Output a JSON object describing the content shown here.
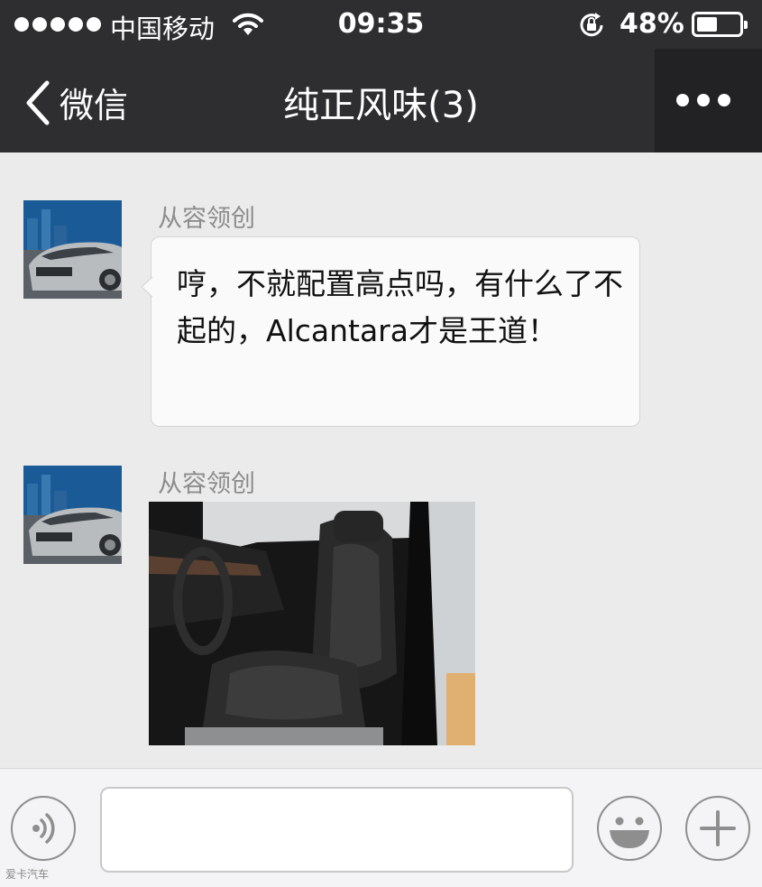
{
  "status_bar": {
    "carrier": "中国移动",
    "time": "09:35",
    "battery": "48%",
    "battery_level": 0.48,
    "signal_icon": "signal-dots-icon",
    "wifi_icon": "wifi-icon",
    "rotation_lock_icon": "rotation-lock-icon"
  },
  "nav": {
    "back_label": "微信",
    "title": "纯正风味(3)",
    "more_icon": "more-dots-icon"
  },
  "messages": [
    {
      "sender": "从容领创",
      "type": "text",
      "text": "哼，不就配置高点吗，有什么了不起的，Alcantara才是王道！"
    },
    {
      "sender": "从容领创",
      "type": "image",
      "image": "car-seat-interior-photo"
    }
  ],
  "input_bar": {
    "voice_icon": "voice-icon",
    "input_value": "",
    "emoji_icon": "emoji-icon",
    "plus_icon": "plus-icon"
  },
  "watermark": "爱卡汽车",
  "colors": {
    "nav_background": "#2e2e31",
    "chat_background": "#ebebeb",
    "bubble_background": "#fafafa",
    "input_bar_background": "#f4f4f6"
  }
}
